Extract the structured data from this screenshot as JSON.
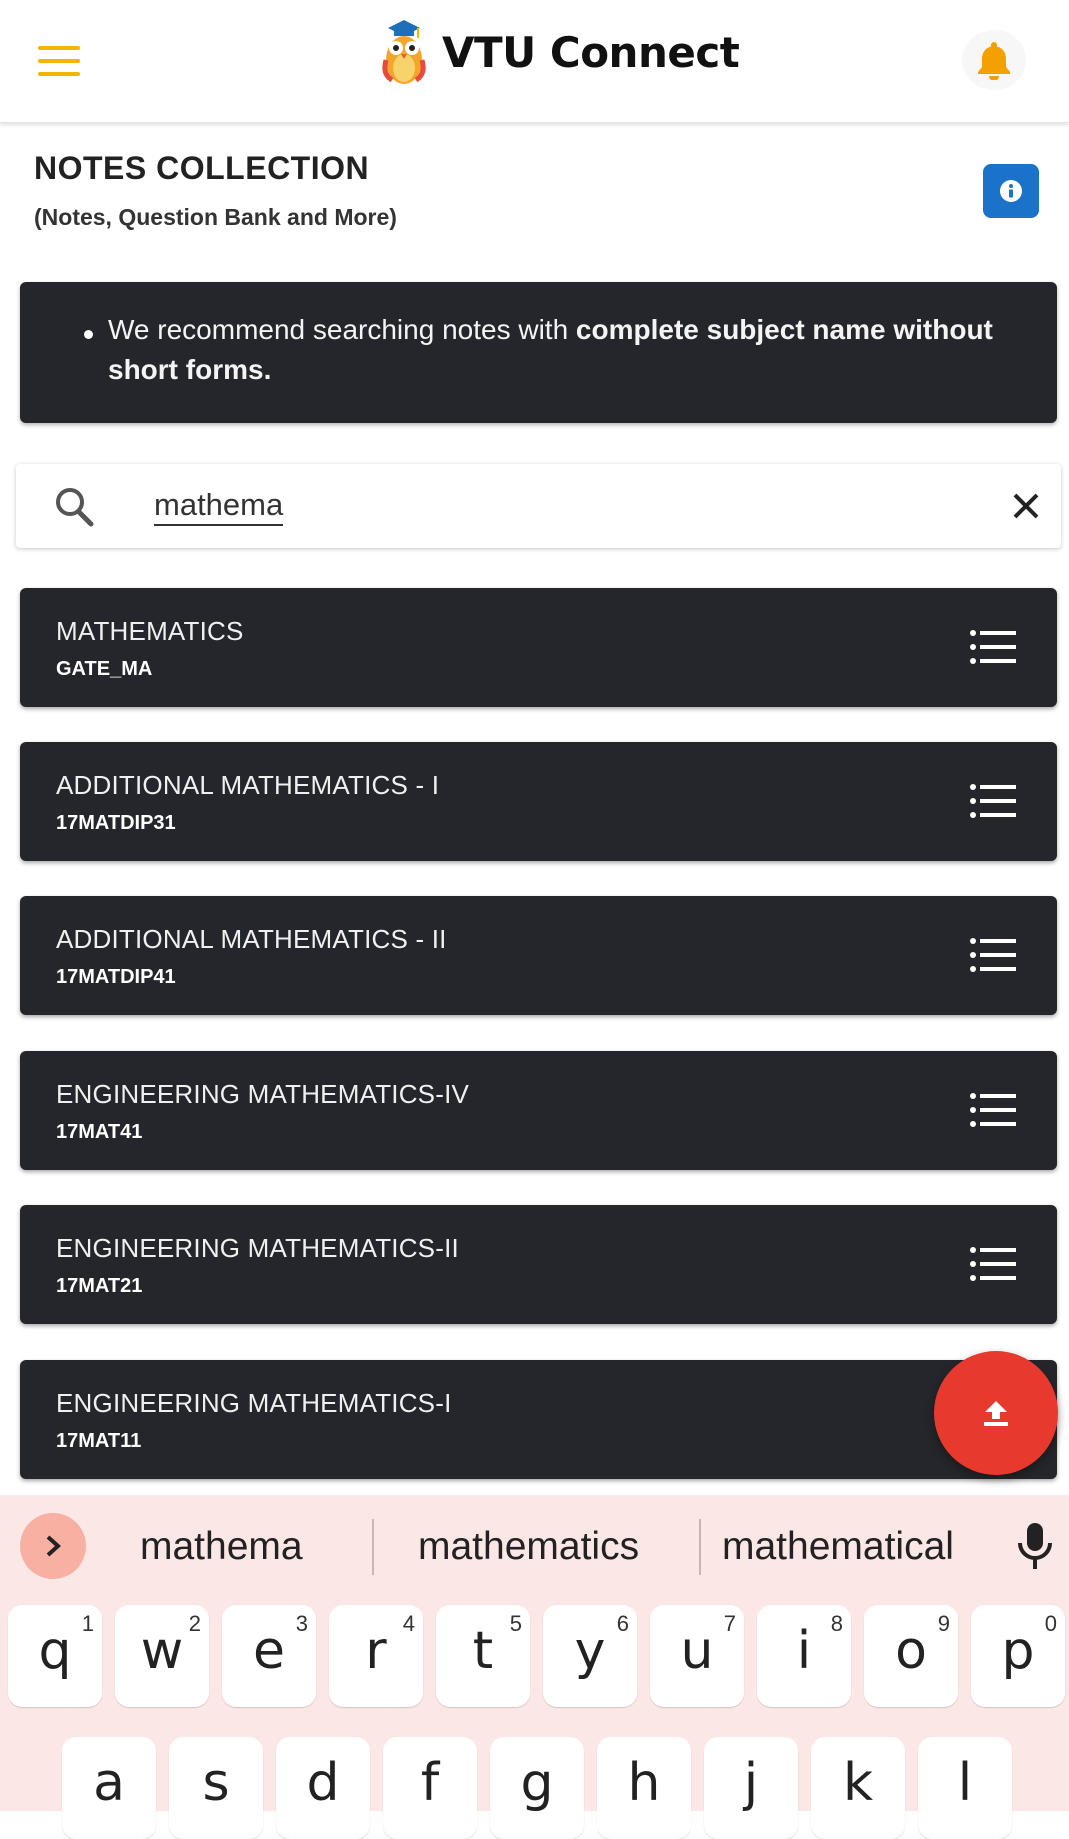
{
  "header": {
    "app_title": "VTU Connect"
  },
  "page": {
    "title": "NOTES COLLECTION",
    "subtitle": "(Notes, Question Bank and More)"
  },
  "notice": {
    "text_normal": "We recommend searching notes with ",
    "text_bold": "complete subject name without short forms."
  },
  "search": {
    "value": "mathema"
  },
  "results": [
    {
      "title": "MATHEMATICS",
      "code": "GATE_MA"
    },
    {
      "title": "ADDITIONAL MATHEMATICS - I",
      "code": "17MATDIP31"
    },
    {
      "title": "ADDITIONAL MATHEMATICS - II",
      "code": "17MATDIP41"
    },
    {
      "title": "ENGINEERING MATHEMATICS-IV",
      "code": "17MAT41"
    },
    {
      "title": "ENGINEERING MATHEMATICS-II",
      "code": "17MAT21"
    },
    {
      "title": "ENGINEERING MATHEMATICS-I",
      "code": "17MAT11"
    }
  ],
  "keyboard": {
    "suggestions": [
      "mathema",
      "mathematics",
      "mathematical"
    ],
    "row1": [
      {
        "key": "q",
        "num": "1"
      },
      {
        "key": "w",
        "num": "2"
      },
      {
        "key": "e",
        "num": "3"
      },
      {
        "key": "r",
        "num": "4"
      },
      {
        "key": "t",
        "num": "5"
      },
      {
        "key": "y",
        "num": "6"
      },
      {
        "key": "u",
        "num": "7"
      },
      {
        "key": "i",
        "num": "8"
      },
      {
        "key": "o",
        "num": "9"
      },
      {
        "key": "p",
        "num": "0"
      }
    ],
    "row2": [
      "a",
      "s",
      "d",
      "f",
      "g",
      "h",
      "j",
      "k",
      "l"
    ]
  },
  "colors": {
    "accent_yellow": "#f4b400",
    "info_blue": "#1a73c9",
    "card_dark": "#25262b",
    "fab_red": "#e8392e",
    "keyboard_bg": "#fbe8e6"
  },
  "icons": {
    "menu": "hamburger-icon",
    "bell": "bell-icon",
    "info": "info-icon",
    "search": "search-icon",
    "clear": "close-icon",
    "list": "list-icon",
    "upload": "upload-icon",
    "mic": "microphone-icon",
    "expand": "chevron-right-icon"
  }
}
